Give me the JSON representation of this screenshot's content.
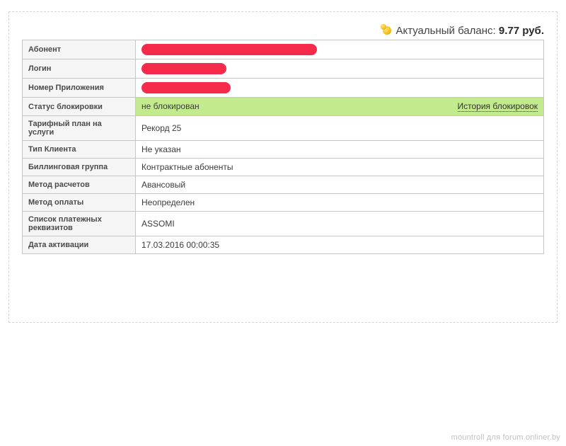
{
  "balance": {
    "label": "Актуальный баланс:",
    "amount": "9.77 руб."
  },
  "rows": {
    "subscriber": {
      "label": "Абонент",
      "value": "",
      "redactWidth": 248
    },
    "login": {
      "label": "Логин",
      "value": "",
      "redactWidth": 120
    },
    "app_no": {
      "label": "Номер Приложения",
      "value": "",
      "redactWidth": 126
    },
    "block_status": {
      "label": "Статус блокировки",
      "value": "не блокирован",
      "history_link": "История блокировок"
    },
    "tariff": {
      "label": "Тарифный план на услуги",
      "value": "Рекорд 25"
    },
    "client_type": {
      "label": "Тип Клиента",
      "value": "Не указан"
    },
    "bill_group": {
      "label": "Биллинговая группа",
      "value": "Контрактные абоненты"
    },
    "calc_method": {
      "label": "Метод расчетов",
      "value": "Авансовый"
    },
    "pay_method": {
      "label": "Метод оплаты",
      "value": "Неопределен"
    },
    "pay_details": {
      "label": "Список платежных реквизитов",
      "value": "ASSOMI"
    },
    "activation": {
      "label": "Дата активации",
      "value": "17.03.2016 00:00:35"
    }
  },
  "watermark": "mountroll для forum.onliner.by"
}
